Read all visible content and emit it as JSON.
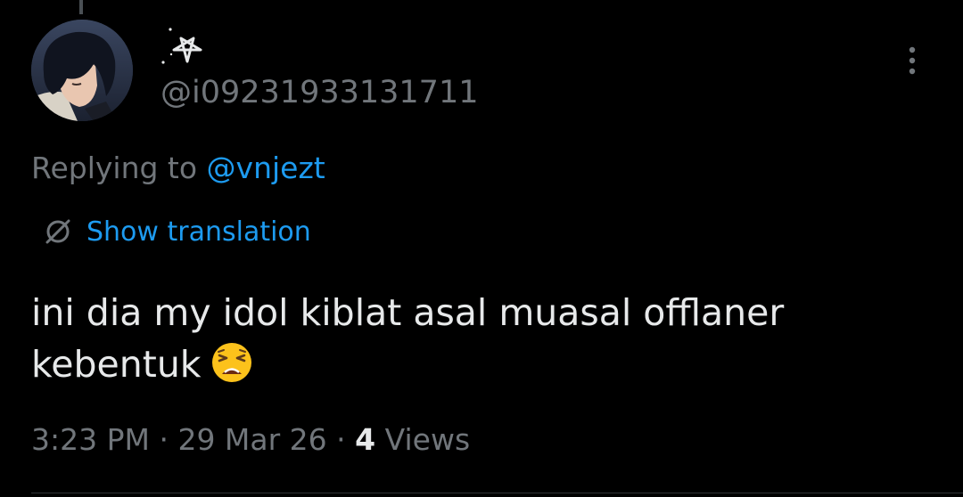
{
  "tweet": {
    "handle": "@i09231933131711",
    "replying_prefix": "Replying to ",
    "replying_to": "@vnjezt",
    "show_translation_label": "Show translation",
    "text_line1": "ini dia my idol kiblat asal muasal offlaner",
    "text_line2": "kebentuk",
    "emoji_name": "tired-face-emoji",
    "time": "3:23 PM",
    "separator": " · ",
    "date": "29 Mar 26",
    "views_count": "4",
    "views_label": " Views",
    "display_name_icon": "pentagram-icon",
    "avatar_icon": "anime-boy-avatar",
    "more_icon": "more-vertical-icon",
    "translate_icon": "globe-slash-icon"
  },
  "colors": {
    "background": "#000000",
    "primary_text": "#e7e9ea",
    "secondary_text": "#71767b",
    "link": "#1d9bf0",
    "divider": "#2f3336"
  }
}
